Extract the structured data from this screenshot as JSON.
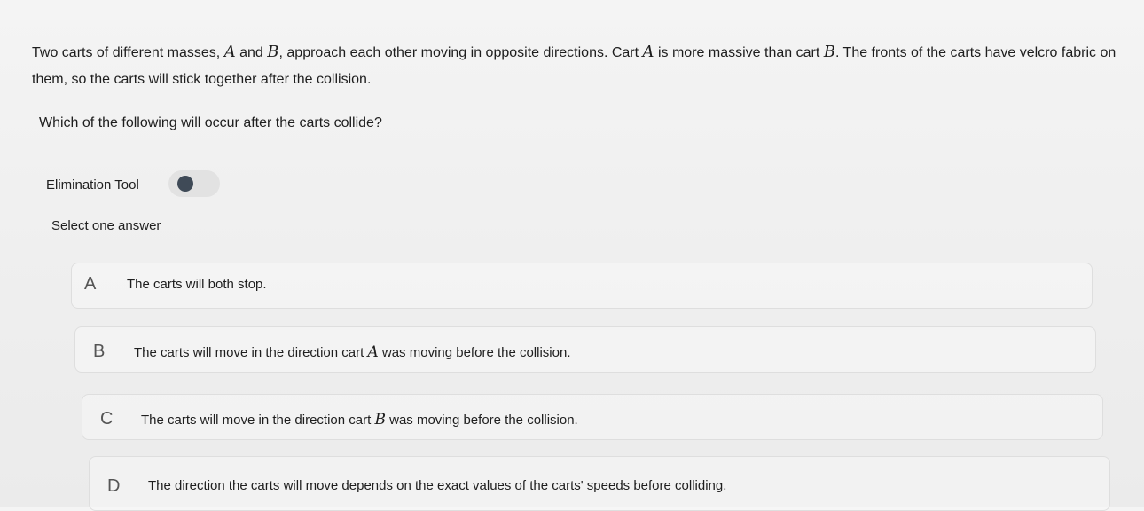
{
  "question": {
    "part1": "Two carts of different masses, ",
    "var_a": "A",
    "part2": " and ",
    "var_b": "B",
    "part3": ", approach each other moving in opposite directions. Cart ",
    "var_a2": "A",
    "part4": " is more massive than cart ",
    "var_b2": "B",
    "part5": ". The fronts of the carts have velcro fabric on them, so the carts will stick together after the collision.",
    "prompt": "Which of the following will occur after the carts collide?"
  },
  "elimination_tool": {
    "label": "Elimination Tool"
  },
  "select_hint": "Select one answer",
  "options": [
    {
      "letter": "A",
      "text": "The carts will both stop."
    },
    {
      "letter": "B",
      "text_before": "The carts will move in the direction cart ",
      "var": "A",
      "text_after": " was moving before the collision."
    },
    {
      "letter": "C",
      "text_before": "The carts will move in the direction cart ",
      "var": "B",
      "text_after": " was moving before the collision."
    },
    {
      "letter": "D",
      "text": "The direction the carts will move depends on the exact values of the carts' speeds before colliding."
    }
  ],
  "colors": {
    "background": "#f0f0f0",
    "toggle_track": "#e2e2e2",
    "toggle_knob": "#3f4a57",
    "option_border": "#dedede"
  }
}
